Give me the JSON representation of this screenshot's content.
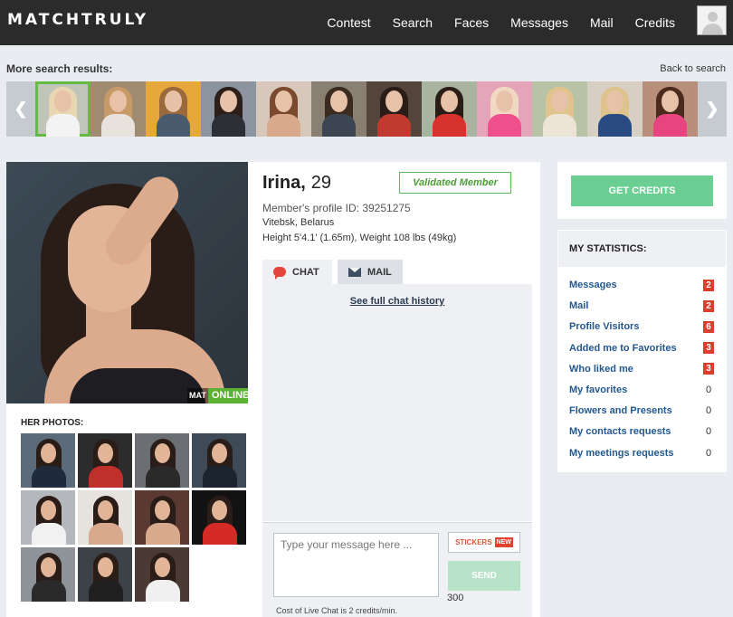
{
  "header": {
    "logo": "MATCHTRULY",
    "nav": [
      "Contest",
      "Search",
      "Faces",
      "Messages",
      "Mail",
      "Credits"
    ]
  },
  "search_strip": {
    "title": "More search results:",
    "back_link": "Back to search",
    "thumbnails": [
      {
        "hair": "#e8d7b2",
        "body": "#f3f3f3",
        "bg": "#bfc6b9"
      },
      {
        "hair": "#c79a67",
        "body": "#e7e2dc",
        "bg": "#a08a70"
      },
      {
        "hair": "#9a6a3c",
        "body": "#4a5b6f",
        "bg": "#e6a83a"
      },
      {
        "hair": "#2c1f1a",
        "body": "#2c2f35",
        "bg": "#8c94a0"
      },
      {
        "hair": "#7b4a2e",
        "body": "#d9a98d",
        "bg": "#d7c8bb"
      },
      {
        "hair": "#3a2a20",
        "body": "#3c4652",
        "bg": "#8a8072"
      },
      {
        "hair": "#2a1d18",
        "body": "#c23a2f",
        "bg": "#54453c"
      },
      {
        "hair": "#2a1d18",
        "body": "#d8322e",
        "bg": "#a8b3a0"
      },
      {
        "hair": "#f0d8c2",
        "body": "#ef4f8b",
        "bg": "#e4a4b9"
      },
      {
        "hair": "#e1c48d",
        "body": "#ece4d5",
        "bg": "#b8c3a6"
      },
      {
        "hair": "#dfc38e",
        "body": "#2a4a83",
        "bg": "#d7cfc3"
      },
      {
        "hair": "#4a2b1e",
        "body": "#e8447f",
        "bg": "#b88f7b"
      }
    ]
  },
  "profile": {
    "name": "Irina,",
    "age": "29",
    "validated": "Validated Member",
    "profile_id": "Member's profile ID: 39251275",
    "location": "Vitebsk, Belarus",
    "height_weight": "Height 5'4.1' (1.65m), Weight 108 lbs (49kg)",
    "watermark": "MAT",
    "status": "ONLINE",
    "photos_title": "HER PHOTOS:",
    "photos": [
      {
        "body": "#1f2b3a",
        "bg": "#5c6b7a"
      },
      {
        "body": "#c0302a",
        "bg": "#2c2c2c"
      },
      {
        "body": "#2a2a2a",
        "bg": "#6b6f73"
      },
      {
        "body": "#1c2430",
        "bg": "#3e4a55"
      },
      {
        "body": "#f1f1f1",
        "bg": "#b4b8bc"
      },
      {
        "body": "#d9a98d",
        "bg": "#e6e2de"
      },
      {
        "body": "#d9a98d",
        "bg": "#5a3a30"
      },
      {
        "body": "#d52b26",
        "bg": "#121212"
      },
      {
        "body": "#2a2a2a",
        "bg": "#8d9398"
      },
      {
        "body": "#202020",
        "bg": "#3c4248"
      },
      {
        "body": "#f0f0f0",
        "bg": "#4a3a33"
      }
    ]
  },
  "chat": {
    "tab_chat": "CHAT",
    "tab_mail": "MAIL",
    "history_link": "See full chat history",
    "input_placeholder": "Type your message here ...",
    "stickers": "STICKERS",
    "new_badge": "NEW",
    "send": "SEND",
    "char_count": "300",
    "cost_note": "Cost of Live Chat is 2 credits/min."
  },
  "sidebar": {
    "get_credits": "GET CREDITS",
    "stats_title": "MY STATISTICS:",
    "stats": [
      {
        "label": "Messages",
        "value": "2",
        "highlight": true
      },
      {
        "label": "Mail",
        "value": "2",
        "highlight": true
      },
      {
        "label": "Profile Visitors",
        "value": "6",
        "highlight": true
      },
      {
        "label": "Added me to Favorites",
        "value": "3",
        "highlight": true
      },
      {
        "label": "Who liked me",
        "value": "3",
        "highlight": true
      },
      {
        "label": "My favorites",
        "value": "0",
        "highlight": false
      },
      {
        "label": "Flowers and Presents",
        "value": "0",
        "highlight": false
      },
      {
        "label": "My contacts requests",
        "value": "0",
        "highlight": false
      },
      {
        "label": "My meetings requests",
        "value": "0",
        "highlight": false
      }
    ]
  }
}
